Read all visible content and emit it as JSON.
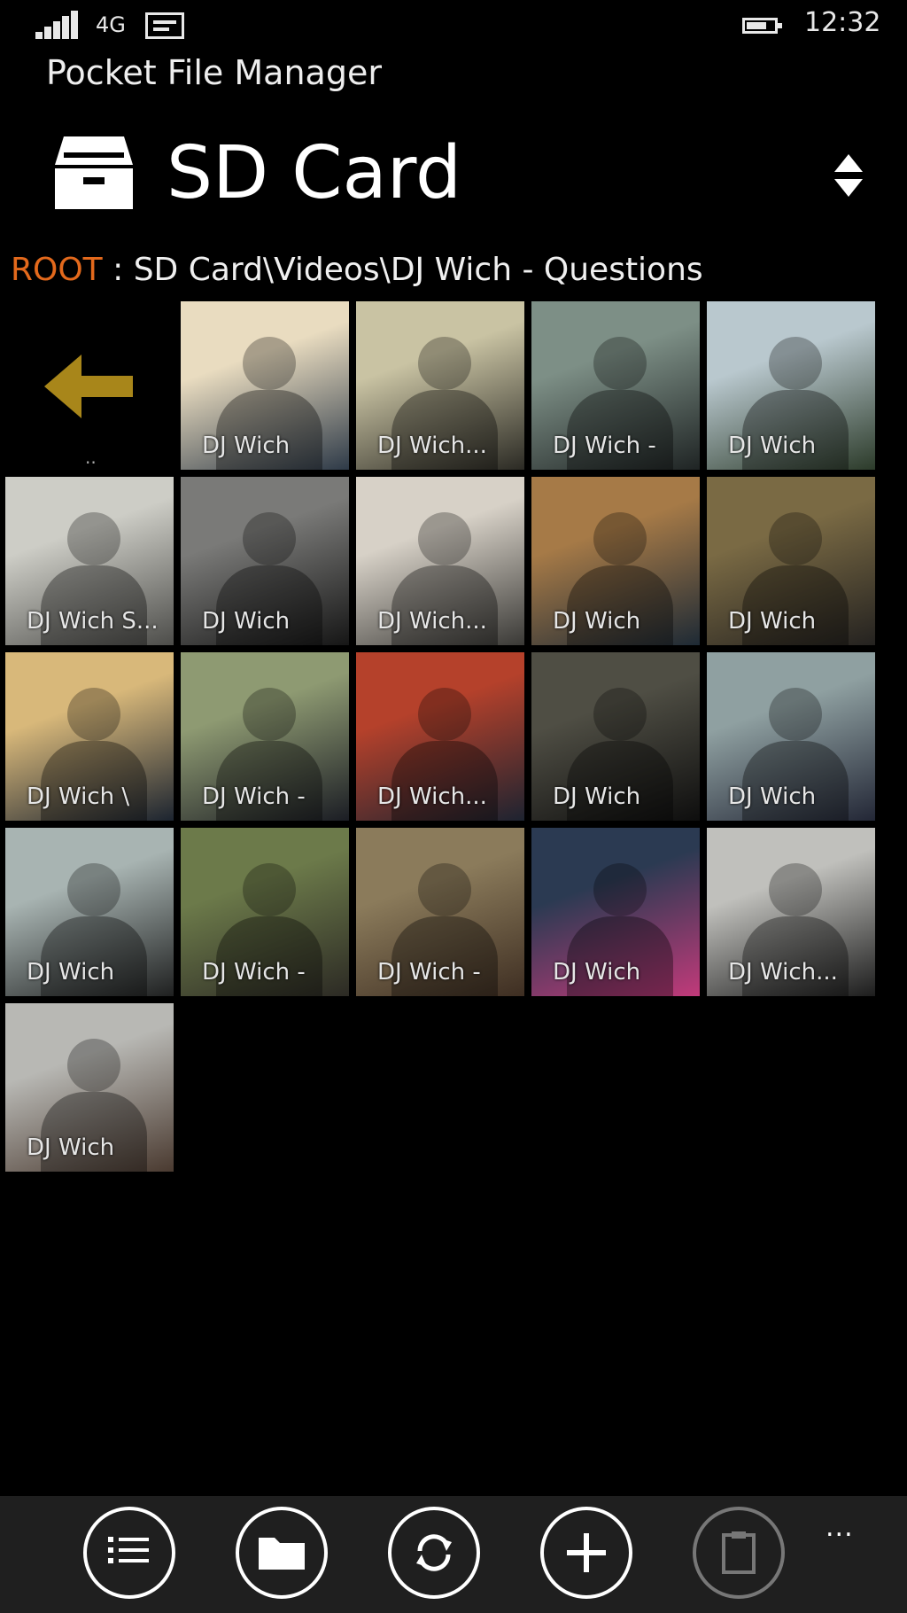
{
  "status": {
    "network": "4G",
    "time": "12:32"
  },
  "app_title": "Pocket File Manager",
  "header": {
    "title": "SD Card",
    "icon": "drive-icon"
  },
  "breadcrumb": {
    "root": "ROOT",
    "separator": " : ",
    "path": "SD Card\\Videos\\DJ Wich - Questions"
  },
  "back_tile": {
    "icon": "back-arrow-icon",
    "label": "..",
    "accent": "#a8861a"
  },
  "tiles": [
    {
      "caption": "DJ Wich",
      "colors": [
        "#e9dcc0",
        "#2e3a48"
      ]
    },
    {
      "caption": "DJ Wich...",
      "colors": [
        "#c9c3a3",
        "#2b2a24"
      ]
    },
    {
      "caption": "DJ Wich -",
      "colors": [
        "#7d8f86",
        "#1f2424"
      ]
    },
    {
      "caption": "DJ Wich",
      "colors": [
        "#b9c8ce",
        "#2c3b2a"
      ]
    },
    {
      "caption": "DJ Wich S...",
      "colors": [
        "#cdcdc6",
        "#4d4d4a"
      ]
    },
    {
      "caption": "DJ Wich",
      "colors": [
        "#7a7a78",
        "#161616"
      ]
    },
    {
      "caption": "DJ Wich...",
      "colors": [
        "#d7d1c7",
        "#3a3936"
      ]
    },
    {
      "caption": "DJ Wich",
      "colors": [
        "#a67a47",
        "#1e2a35"
      ]
    },
    {
      "caption": "DJ Wich",
      "colors": [
        "#7a6a44",
        "#242220"
      ]
    },
    {
      "caption": "DJ Wich \\",
      "colors": [
        "#d8b87a",
        "#1c2430"
      ]
    },
    {
      "caption": "DJ Wich -",
      "colors": [
        "#8e9a72",
        "#1b1d24"
      ]
    },
    {
      "caption": "DJ Wich...",
      "colors": [
        "#b5412b",
        "#1d2330"
      ]
    },
    {
      "caption": "DJ Wich",
      "colors": [
        "#4f4e44",
        "#0e0e0e"
      ]
    },
    {
      "caption": "DJ Wich",
      "colors": [
        "#8fa0a1",
        "#232736"
      ]
    },
    {
      "caption": "DJ Wich",
      "colors": [
        "#a8b4b2",
        "#1f2020"
      ]
    },
    {
      "caption": "DJ Wich -",
      "colors": [
        "#6c7a4a",
        "#2c2a24"
      ]
    },
    {
      "caption": "DJ Wich -",
      "colors": [
        "#8b7b5b",
        "#3e2e22"
      ]
    },
    {
      "caption": "DJ Wich",
      "colors": [
        "#2b3a52",
        "#c13a7a"
      ]
    },
    {
      "caption": "DJ Wich...",
      "colors": [
        "#c0c0bc",
        "#1d1d1d"
      ]
    },
    {
      "caption": "DJ Wich",
      "colors": [
        "#b8b8b4",
        "#4a3a30"
      ]
    }
  ],
  "appbar": {
    "buttons": [
      {
        "name": "select-list-button",
        "icon": "list-icon",
        "enabled": true
      },
      {
        "name": "new-folder-button",
        "icon": "folder-icon",
        "enabled": true
      },
      {
        "name": "refresh-button",
        "icon": "refresh-icon",
        "enabled": true
      },
      {
        "name": "add-button",
        "icon": "plus-icon",
        "enabled": true
      },
      {
        "name": "paste-button",
        "icon": "clipboard-icon",
        "enabled": false
      }
    ],
    "more": "..."
  }
}
